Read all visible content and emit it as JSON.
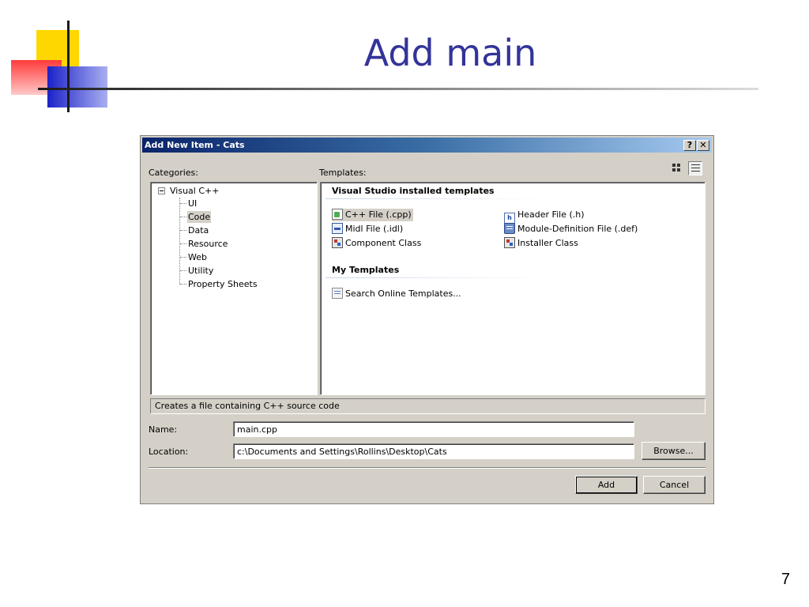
{
  "slide": {
    "title": "Add main",
    "page_number": "7"
  },
  "dialog": {
    "title": "Add New Item - Cats",
    "help_glyph": "?",
    "close_glyph": "✕",
    "categories_label": "Categories:",
    "templates_label": "Templates:",
    "categories": {
      "root": "Visual C++",
      "items": [
        "UI",
        "Code",
        "Data",
        "Resource",
        "Web",
        "Utility",
        "Property Sheets"
      ],
      "selected": "Code"
    },
    "templates": {
      "installed_header": "Visual Studio installed templates",
      "installed": [
        {
          "label": "C++ File (.cpp)",
          "icon": "cpp-file-icon"
        },
        {
          "label": "Header File (.h)",
          "icon": "header-file-icon"
        },
        {
          "label": "Midl File (.idl)",
          "icon": "midl-file-icon"
        },
        {
          "label": "Module-Definition File (.def)",
          "icon": "module-definition-icon"
        },
        {
          "label": "Component Class",
          "icon": "component-class-icon"
        },
        {
          "label": "Installer Class",
          "icon": "installer-class-icon"
        }
      ],
      "header_icon_glyph": "h",
      "my_header": "My Templates",
      "my": [
        {
          "label": "Search Online Templates...",
          "icon": "search-online-icon"
        }
      ],
      "selected": "C++ File (.cpp)"
    },
    "description": "Creates a file containing C++ source code",
    "name_label": "Name:",
    "name_value": "main.cpp",
    "location_label": "Location:",
    "location_value": "c:\\Documents and Settings\\Rollins\\Desktop\\Cats",
    "browse_label": "Browse...",
    "add_label": "Add",
    "cancel_label": "Cancel"
  },
  "colors": {
    "title_text": "#333399",
    "titlebar_start": "#0a246a",
    "dialog_face": "#d4d0c8"
  }
}
